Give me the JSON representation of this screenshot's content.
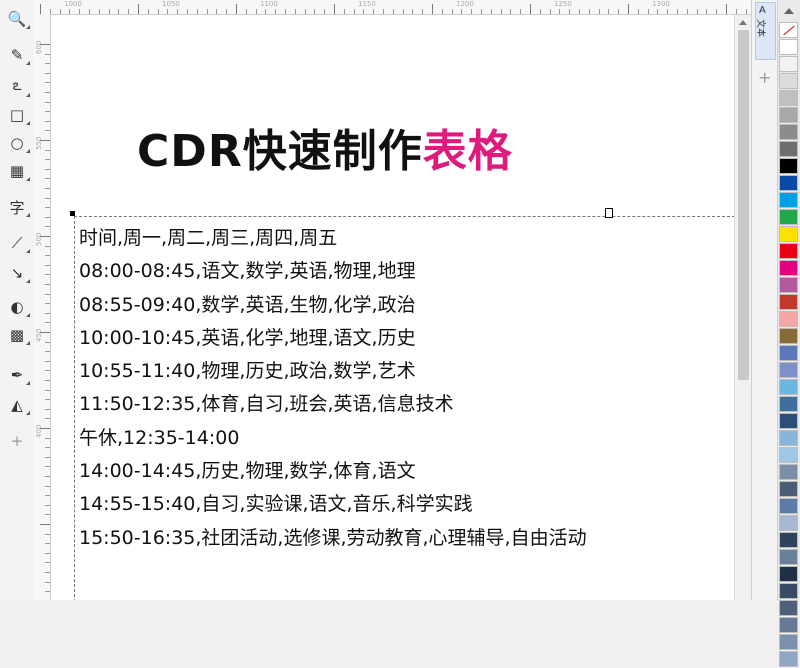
{
  "toolbox": {
    "tools": [
      {
        "name": "zoom-tool",
        "glyph": "🔍"
      },
      {
        "name": "freehand-tool",
        "glyph": "✎"
      },
      {
        "name": "curve-tool",
        "glyph": "ఽ"
      },
      {
        "name": "rectangle-tool",
        "glyph": "□"
      },
      {
        "name": "ellipse-tool",
        "glyph": "○"
      },
      {
        "name": "table-tool",
        "glyph": "▦"
      },
      {
        "name": "text-tool",
        "glyph": "字"
      },
      {
        "name": "parallel-dimension-tool",
        "glyph": "⟋"
      },
      {
        "name": "connector-tool",
        "glyph": "↘"
      },
      {
        "name": "shadow-tool",
        "glyph": "◐"
      },
      {
        "name": "transparency-tool",
        "glyph": "▩"
      },
      {
        "name": "eyedropper-tool",
        "glyph": "✒"
      },
      {
        "name": "fill-tool",
        "glyph": "◭"
      },
      {
        "name": "add-tool",
        "glyph": "+"
      }
    ]
  },
  "ruler_top": {
    "labels": [
      "1000",
      "1050",
      "1100",
      "1150",
      "1200",
      "1250",
      "1300"
    ]
  },
  "ruler_left": {
    "labels": [
      "600",
      "550",
      "500",
      "450",
      "400"
    ]
  },
  "canvas": {
    "headline_black": "CDR快速制作",
    "headline_pink": "表格",
    "lines": [
      "时间,周一,周二,周三,周四,周五",
      "08:00-08:45,语文,数学,英语,物理,地理",
      "08:55-09:40,数学,英语,生物,化学,政治",
      "10:00-10:45,英语,化学,地理,语文,历史",
      "10:55-11:40,物理,历史,政治,数学,艺术",
      "11:50-12:35,体育,自习,班会,英语,信息技术",
      "午休,12:35-14:00",
      "14:00-14:45,历史,物理,数学,体育,语文",
      "14:55-15:40,自习,实验课,语文,音乐,科学实践",
      "15:50-16:35,社团活动,选修课,劳动教育,心理辅导,自由活动"
    ]
  },
  "docker": {
    "tab_label": "文本",
    "tab_icon": "A",
    "add_glyph": "+"
  },
  "palette": {
    "colors": [
      "#ffffff",
      "#f2f2f2",
      "#dcdcdc",
      "#c0c0c0",
      "#a8a8a8",
      "#8c8c8c",
      "#6e6e6e",
      "#000000",
      "#0a4aa6",
      "#00a0e9",
      "#22a84a",
      "#ffe100",
      "#e60012",
      "#e4007f",
      "#b05aa0",
      "#c0392b",
      "#f4a6a6",
      "#8b6a3a",
      "#5b79b8",
      "#7f8fc9",
      "#6db6e0",
      "#3e6f9e",
      "#2b4f7a",
      "#8ab4d6",
      "#9fc8e8",
      "#7c8ea6",
      "#4c5c74",
      "#5e7aa6",
      "#a8b8d0",
      "#30435e",
      "#6a7f9a",
      "#1f2f45",
      "#3a4a62",
      "#50607a",
      "#667a96",
      "#7c90ae",
      "#92a6c6"
    ]
  },
  "colors": {
    "headline_pink": "#e0197d",
    "headline_black": "#111111"
  }
}
